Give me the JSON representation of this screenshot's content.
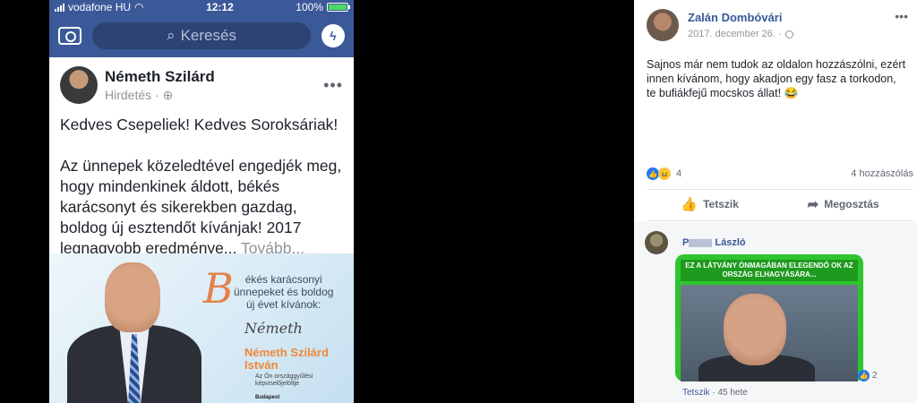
{
  "phone": {
    "status": {
      "carrier": "vodafone HU",
      "time": "12:12",
      "battery": "100%",
      "battery_level": 1.0
    },
    "search_placeholder": "Keresés",
    "post": {
      "author": "Németh Szilárd",
      "sub": "Hirdetés ·",
      "greeting": "Kedves Csepeliek! Kedves Soroksáriak!",
      "body": "Az ünnepek közeledtével engedjék meg, hogy mindenkinek áldott, békés karácsonyt és sikerekben gazdag, boldog új esztendőt kívánjak! 2017 legnagyobb eredménye...",
      "more": "Tovább..."
    },
    "ad": {
      "big_letter": "B",
      "greeting_lines": [
        "ékés karácsonyi",
        "ünnepeket és boldog",
        "új évet kívánok:"
      ],
      "signature": "Németh",
      "name_line1": "Németh Szilárd",
      "name_line2": "István",
      "small1": "Az Ön országgyűlési",
      "small2": "képviselőjelöltje",
      "city": "Budapest"
    }
  },
  "post": {
    "author": "Zalán Dombóvári",
    "date": "2017. december 26. ·",
    "text": "Sajnos már nem tudok az oldalon hozzászólni, ezért innen kívánom, hogy akadjon egy fasz a torkodon, te bufiákfejű mocskos állat! 😂",
    "reaction_count": "4",
    "comment_count": "4 hozzászólás",
    "like_label": "Tetszik",
    "share_label": "Megosztás",
    "comment": {
      "name_start": "P",
      "name_end": "László",
      "meme_text": "EZ A LÁTVÁNY ÖNMAGÁBAN ELEGENDŐ OK AZ ORSZÁG ELHAGYÁSÁRA...",
      "reaction_count": "2",
      "like_label": "Tetszik",
      "age": "45 hete"
    }
  }
}
